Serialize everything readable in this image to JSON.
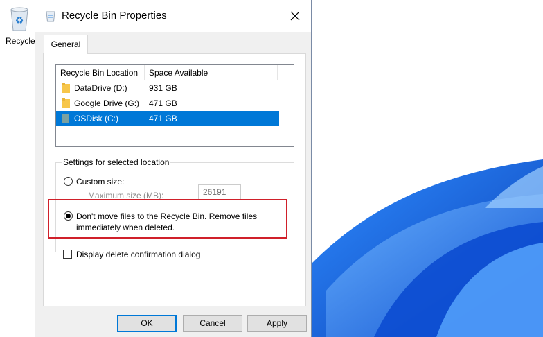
{
  "desktop": {
    "recycle_bin_label": "Recycle"
  },
  "dialog": {
    "title": "Recycle Bin Properties",
    "tab_general": "General",
    "list": {
      "columns": [
        "Recycle Bin Location",
        "Space Available"
      ],
      "rows": [
        {
          "name": "DataDrive (D:)",
          "space": "931 GB",
          "selected": false
        },
        {
          "name": "Google Drive (G:)",
          "space": "471 GB",
          "selected": false
        },
        {
          "name": "OSDisk (C:)",
          "space": "471 GB",
          "selected": true
        }
      ]
    },
    "settings": {
      "group_label": "Settings for selected location",
      "custom_size_label": "Custom size:",
      "max_size_label": "Maximum size (MB):",
      "max_size_value": "26191",
      "dont_move_label_line1": "Don't move files to the Recycle Bin. Remove files",
      "dont_move_label_line2": "immediately when deleted.",
      "selected_option": "dont_move"
    },
    "confirm_label": "Display delete confirmation dialog",
    "confirm_checked": false,
    "buttons": {
      "ok": "OK",
      "cancel": "Cancel",
      "apply": "Apply"
    }
  },
  "colors": {
    "selection": "#0078d7",
    "highlight_border": "#d0202a",
    "wallpaper_blue": "#1a6fe0"
  }
}
